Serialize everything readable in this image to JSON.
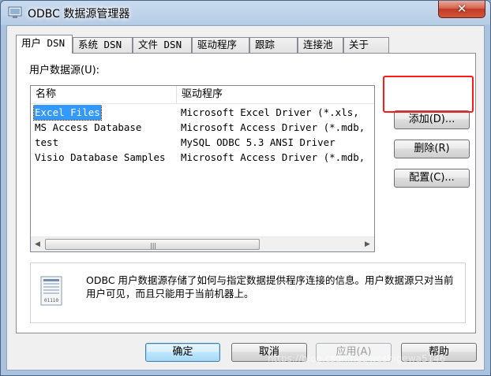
{
  "window": {
    "title": "ODBC 数据源管理器",
    "close_glyph": "✕"
  },
  "tabs": [
    "用户 DSN",
    "系统 DSN",
    "文件 DSN",
    "驱动程序",
    "跟踪",
    "连接池",
    "关于"
  ],
  "panel": {
    "label": "用户数据源(U):",
    "columns": [
      "名称",
      "驱动程序"
    ],
    "rows": [
      {
        "name": "Excel Files",
        "driver": "Microsoft Excel Driver (*.xls,"
      },
      {
        "name": "MS Access Database",
        "driver": "Microsoft Access Driver (*.mdb,"
      },
      {
        "name": "test",
        "driver": "MySQL ODBC 5.3 ANSI Driver"
      },
      {
        "name": "Visio Database Samples",
        "driver": "Microsoft Access Driver (*.mdb,"
      }
    ],
    "scroll_grip": "|||",
    "buttons": {
      "add": "添加(D)...",
      "remove": "删除(R)",
      "configure": "配置(C)..."
    },
    "info_text": "ODBC 用户数据源存储了如何与指定数据提供程序连接的信息。用户数据源只对当前用户可见，而且只能用于当前机器上。"
  },
  "dialog_buttons": {
    "ok": "确定",
    "cancel": "取消",
    "apply": "应用(A)",
    "help": "帮助"
  },
  "watermark": "https://blog.csdn.net/woshigewa5146",
  "colors": {
    "selection": "#3399ff",
    "highlight_box": "#ff1a1a",
    "close_button": "#c94a35"
  }
}
